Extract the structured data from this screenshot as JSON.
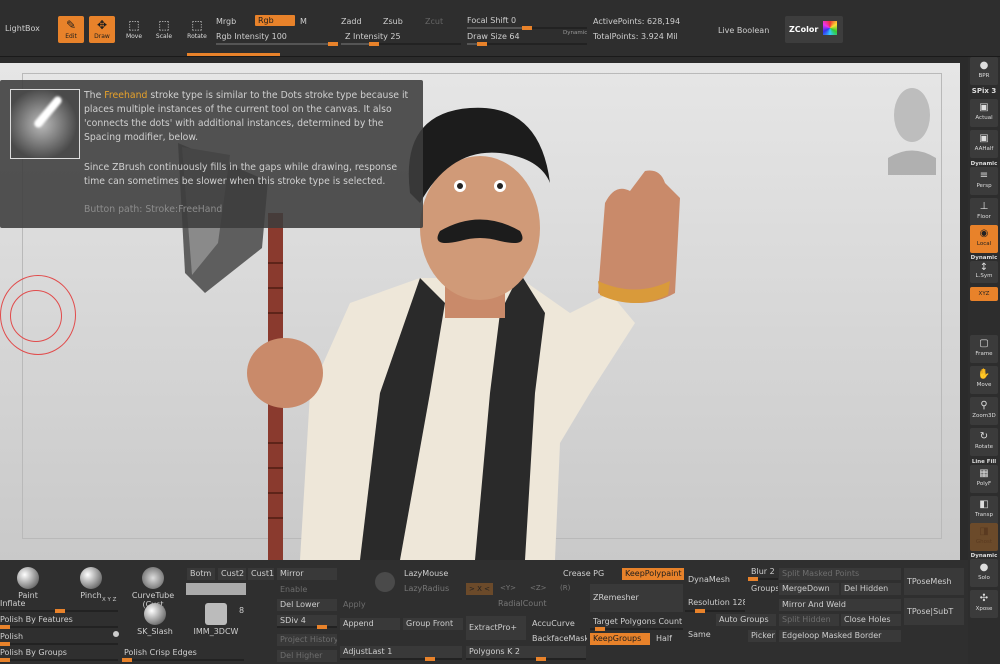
{
  "toolbar": {
    "lightbox": "LightBox",
    "edit": "Edit",
    "draw": "Draw",
    "move": "Move",
    "scale": "Scale",
    "rotate": "Rotate",
    "mrgb": "Mrgb",
    "rgb": "Rgb",
    "m": "M",
    "rgb_intensity": "Rgb Intensity 100",
    "rgb_intensity_value": 100,
    "zadd": "Zadd",
    "zsub": "Zsub",
    "zcut": "Zcut",
    "z_intensity": "Z Intensity 25",
    "z_intensity_value": 25,
    "focal_shift": "Focal Shift 0",
    "draw_size": "Draw Size 64",
    "dynamic": "Dynamic",
    "active_points": "ActivePoints: 628,194",
    "total_points": "TotalPoints: 3.924 Mil",
    "live_boolean": "Live Boolean",
    "zcolor": "ZColor"
  },
  "tooltip": {
    "line1_a": "The ",
    "line1_hl": "Freehand",
    "line1_b": " stroke type is similar to the Dots stroke type because it places multiple instances of the current tool on the canvas. It also 'connects the dots' with additional instances, determined by the Spacing modifier, below.",
    "line2": "Since ZBrush continuously fills in the gaps while drawing, response time can sometimes be slower when this stroke type is selected.",
    "path": "Button path: Stroke:FreeHand"
  },
  "right_shelf": {
    "bpr": "BPR",
    "spix": "SPix 3",
    "actual": "Actual",
    "aahalf": "AAHalf",
    "dynamic": "Dynamic",
    "persp": "Persp",
    "floor": "Floor",
    "local": "Local",
    "dynamic2": "Dynamic",
    "lsym": "L.Sym",
    "xyz": "XYZ",
    "frame": "Frame",
    "move": "Move",
    "zoom3d": "Zoom3D",
    "rotate": "Rotate",
    "line_fill": "Line Fill",
    "polyf": "PolyF",
    "transp": "Transp",
    "ghost": "Ghost",
    "dynamic3": "Dynamic",
    "solo": "Solo",
    "xpose": "Xpose"
  },
  "bottom": {
    "brushes": [
      "Paint",
      "Pinch",
      "CurveTube (Cust",
      "SK_Slash",
      "IMM_3DCW"
    ],
    "imm_count": "8",
    "xyz_label": "X Y Z",
    "inflate": "Inflate",
    "polish_by_features": "Polish By Features",
    "polish": "Polish",
    "polish_by_groups": "Polish By Groups",
    "polish_crisp_edges": "Polish Crisp Edges",
    "botm": "Botm",
    "cust2": "Cust2",
    "cust1": "Cust1",
    "mirror": "Mirror",
    "enable": "Enable",
    "del_lower": "Del Lower",
    "sdiv": "SDiv 4",
    "project_history": "Project History",
    "del_higher": "Del Higher",
    "apply": "Apply",
    "append": "Append",
    "adjust_last": "AdjustLast 1",
    "lazymouse": "LazyMouse",
    "lazyradius": "LazyRadius",
    "lazy_x": "> X <",
    "lazy_y": "<Y>",
    "lazy_z": "<Z>",
    "lazy_r": "(R)",
    "radial_count": "RadialCount",
    "group_front": "Group Front",
    "extract_pro": "ExtractPro+",
    "accucurve": "AccuCurve",
    "backface_mask": "BackfaceMask",
    "polygons_k": "Polygons K 2",
    "crease_pg": "Crease PG",
    "keep_polypaint": "KeepPolypaint",
    "zremesher": "ZRemesher",
    "target_polygons": "Target Polygons Count 1",
    "keep_groups": "KeepGroups",
    "half": "Half",
    "same": "Same",
    "dynamesh": "DynaMesh",
    "resolution": "Resolution 128",
    "blur": "Blur 2",
    "groups": "Groups",
    "auto_groups": "Auto Groups",
    "picker": "Picker",
    "split_masked_points": "Split Masked Points",
    "merge_down": "MergeDown",
    "del_hidden": "Del Hidden",
    "mirror_and_weld": "Mirror And Weld",
    "split_hidden": "Split Hidden",
    "close_holes": "Close Holes",
    "edgeloop_masked_border": "Edgeloop Masked Border",
    "tpose_mesh": "TPoseMesh",
    "tpose_subt": "TPose|SubT"
  },
  "colors": {
    "accent": "#e8822a",
    "panel": "#2e2e2e",
    "viewport_top": "#e6e6e6",
    "viewport_bottom": "#c9c9c9"
  }
}
